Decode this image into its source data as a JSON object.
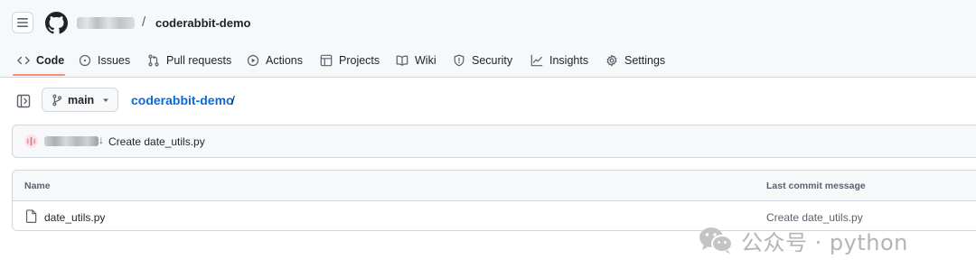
{
  "header": {
    "owner": "",
    "separator": "/",
    "repo_name": "coderabbit-demo"
  },
  "tabs": [
    {
      "label": "Code",
      "icon": "code-icon",
      "active": true
    },
    {
      "label": "Issues",
      "icon": "issue-opened-icon",
      "active": false
    },
    {
      "label": "Pull requests",
      "icon": "git-pull-request-icon",
      "active": false
    },
    {
      "label": "Actions",
      "icon": "play-icon",
      "active": false
    },
    {
      "label": "Projects",
      "icon": "table-icon",
      "active": false
    },
    {
      "label": "Wiki",
      "icon": "book-icon",
      "active": false
    },
    {
      "label": "Security",
      "icon": "shield-icon",
      "active": false
    },
    {
      "label": "Insights",
      "icon": "graph-icon",
      "active": false
    },
    {
      "label": "Settings",
      "icon": "gear-icon",
      "active": false
    }
  ],
  "toolbar": {
    "branch": "main",
    "breadcrumb_repo": "coderabbit-demo",
    "breadcrumb_sep": "/"
  },
  "latest_commit": {
    "author": "",
    "arrow": "↓",
    "message": "Create date_utils.py"
  },
  "files_table": {
    "headers": {
      "name": "Name",
      "last_commit": "Last commit message"
    },
    "rows": [
      {
        "name": "date_utils.py",
        "commit_message": "Create date_utils.py",
        "icon": "file-icon"
      }
    ]
  },
  "watermark": {
    "text": "公众号 · python",
    "icon": "wechat-icon"
  },
  "colors": {
    "accent_link": "#0969da",
    "tab_underline": "#fd8c73",
    "border": "#d0d7de",
    "header_bg": "#f6f8fa"
  }
}
